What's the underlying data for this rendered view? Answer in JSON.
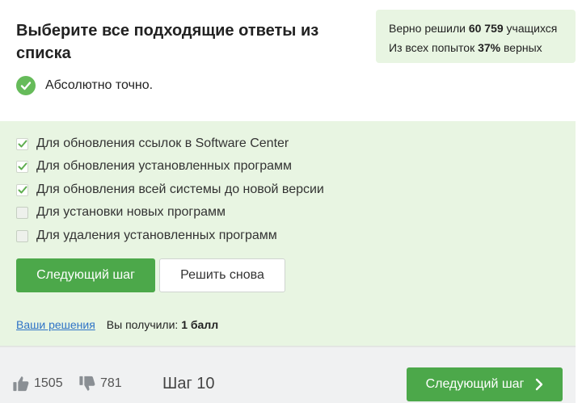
{
  "header": {
    "title": "Выберите все подходящие ответы из списка",
    "verdict": "Абсолютно точно."
  },
  "stats": {
    "solved_prefix": "Верно решили",
    "solved_count": "60 759",
    "solved_suffix": "учащихся",
    "attempts_prefix": "Из всех попыток",
    "attempts_percent": "37%",
    "attempts_suffix": "верных"
  },
  "options": [
    {
      "label": "Для обновления ссылок в Software Center",
      "checked": true
    },
    {
      "label": "Для обновления установленных программ",
      "checked": true
    },
    {
      "label": "Для обновления всей системы до новой версии",
      "checked": true
    },
    {
      "label": "Для установки новых программ",
      "checked": false
    },
    {
      "label": "Для удаления установленных программ",
      "checked": false
    }
  ],
  "buttons": {
    "next": "Следующий шаг",
    "retry": "Решить снова"
  },
  "result": {
    "solutions_link": "Ваши решения",
    "score_prefix": "Вы получили:",
    "score_value": "1 балл"
  },
  "footer": {
    "likes": "1505",
    "dislikes": "781",
    "step": "Шаг 10",
    "next": "Следующий шаг"
  },
  "colors": {
    "accent": "#4ca84a",
    "answer_bg": "#e8f5e2",
    "link": "#2f73c6"
  },
  "icons": [
    "check-circle-icon",
    "checkmark-icon",
    "thumbs-up-icon",
    "thumbs-down-icon",
    "chevron-right-icon"
  ]
}
